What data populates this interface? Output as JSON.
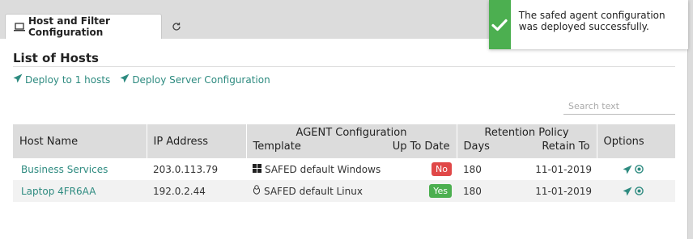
{
  "tabs": [
    {
      "label": "Host and Filter Configuration"
    }
  ],
  "page": {
    "title": "List of Hosts"
  },
  "actions": {
    "deploy_hosts": "Deploy to 1 hosts",
    "deploy_server": "Deploy Server Configuration"
  },
  "search": {
    "placeholder": "Search text"
  },
  "table": {
    "headers": {
      "host_name": "Host Name",
      "ip_address": "IP Address",
      "agent_config": "AGENT Configuration",
      "template": "Template",
      "up_to_date": "Up To Date",
      "retention_policy": "Retention Policy",
      "days": "Days",
      "retain_to": "Retain To",
      "options": "Options"
    },
    "rows": [
      {
        "host": "Business Services",
        "ip": "203.0.113.79",
        "os_icon": "windows-icon",
        "template": "SAFED default Windows",
        "status": "No",
        "days": "180",
        "retain_to": "11-01-2019"
      },
      {
        "host": "Laptop 4FR6AA",
        "ip": "192.0.2.44",
        "os_icon": "linux-icon",
        "template": "SAFED default Linux",
        "status": "Yes",
        "days": "180",
        "retain_to": "11-01-2019"
      }
    ]
  },
  "toast": {
    "message": "The safed agent configuration was deployed successfully.",
    "icon": "checkmark-icon"
  },
  "colors": {
    "accent": "#2e8b80",
    "success": "#4caf50",
    "danger": "#e04848",
    "header_bg": "#dcdcdc"
  }
}
